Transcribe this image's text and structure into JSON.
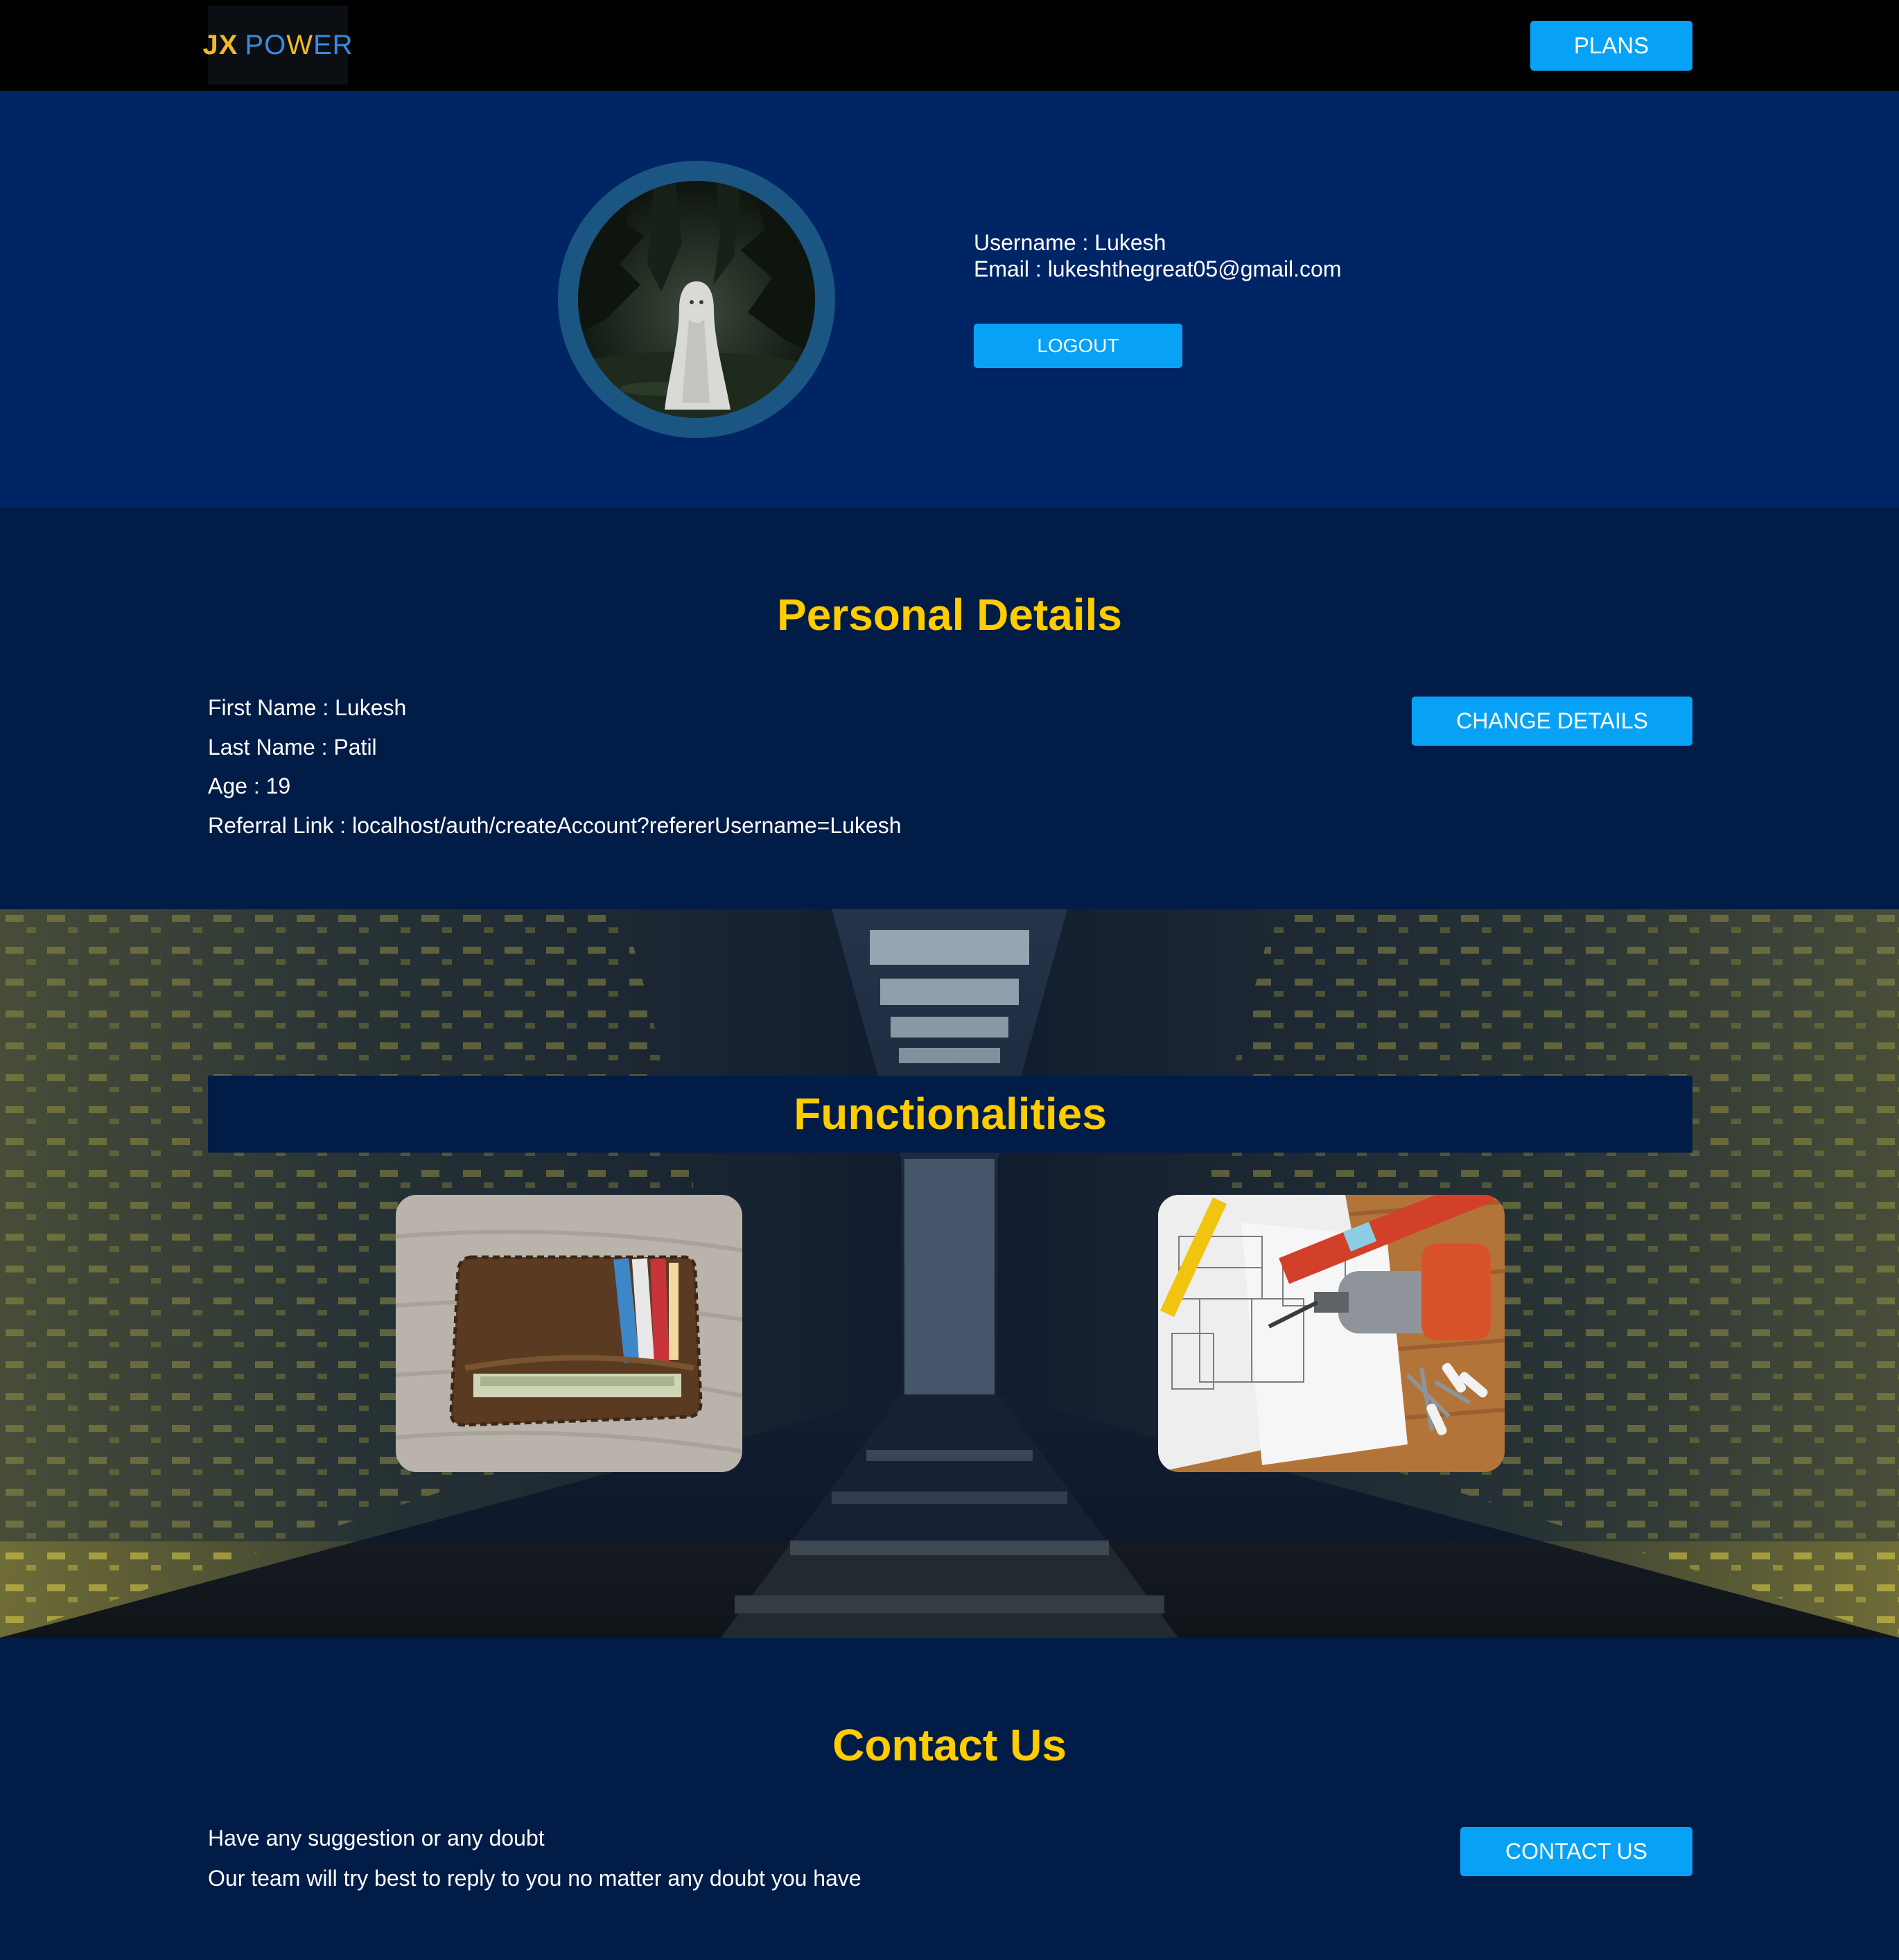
{
  "header": {
    "logo": {
      "part1": "JX",
      "part2a": "PO",
      "part2b": "W",
      "part2c": "ER"
    },
    "plans_label": "PLANS"
  },
  "profile": {
    "username_label": "Username : ",
    "username": "Lukesh",
    "email_label": "Email : ",
    "email": "lukeshthegreat05@gmail.com",
    "logout_label": "LOGOUT"
  },
  "personal_details": {
    "title": "Personal Details",
    "first_name_label": "First Name : ",
    "first_name": "Lukesh",
    "last_name_label": "Last Name : ",
    "last_name": "Patil",
    "age_label": "Age : ",
    "age": "19",
    "referral_label": "Referral Link : ",
    "referral_link": "localhost/auth/createAccount?refererUsername=Lukesh",
    "change_label": "CHANGE DETAILS"
  },
  "functionalities": {
    "title": "Functionalities"
  },
  "contact": {
    "title": "Contact Us",
    "line1": "Have any suggestion or any doubt",
    "line2": "Our team will try best to reply to you no matter any doubt you have",
    "button_label": "CONTACT US"
  },
  "colors": {
    "accent_button": "#07a2f5",
    "heading": "#ffcc00",
    "navy": "#001c47",
    "profile_bg": "#002565",
    "header_bg": "#000000"
  }
}
